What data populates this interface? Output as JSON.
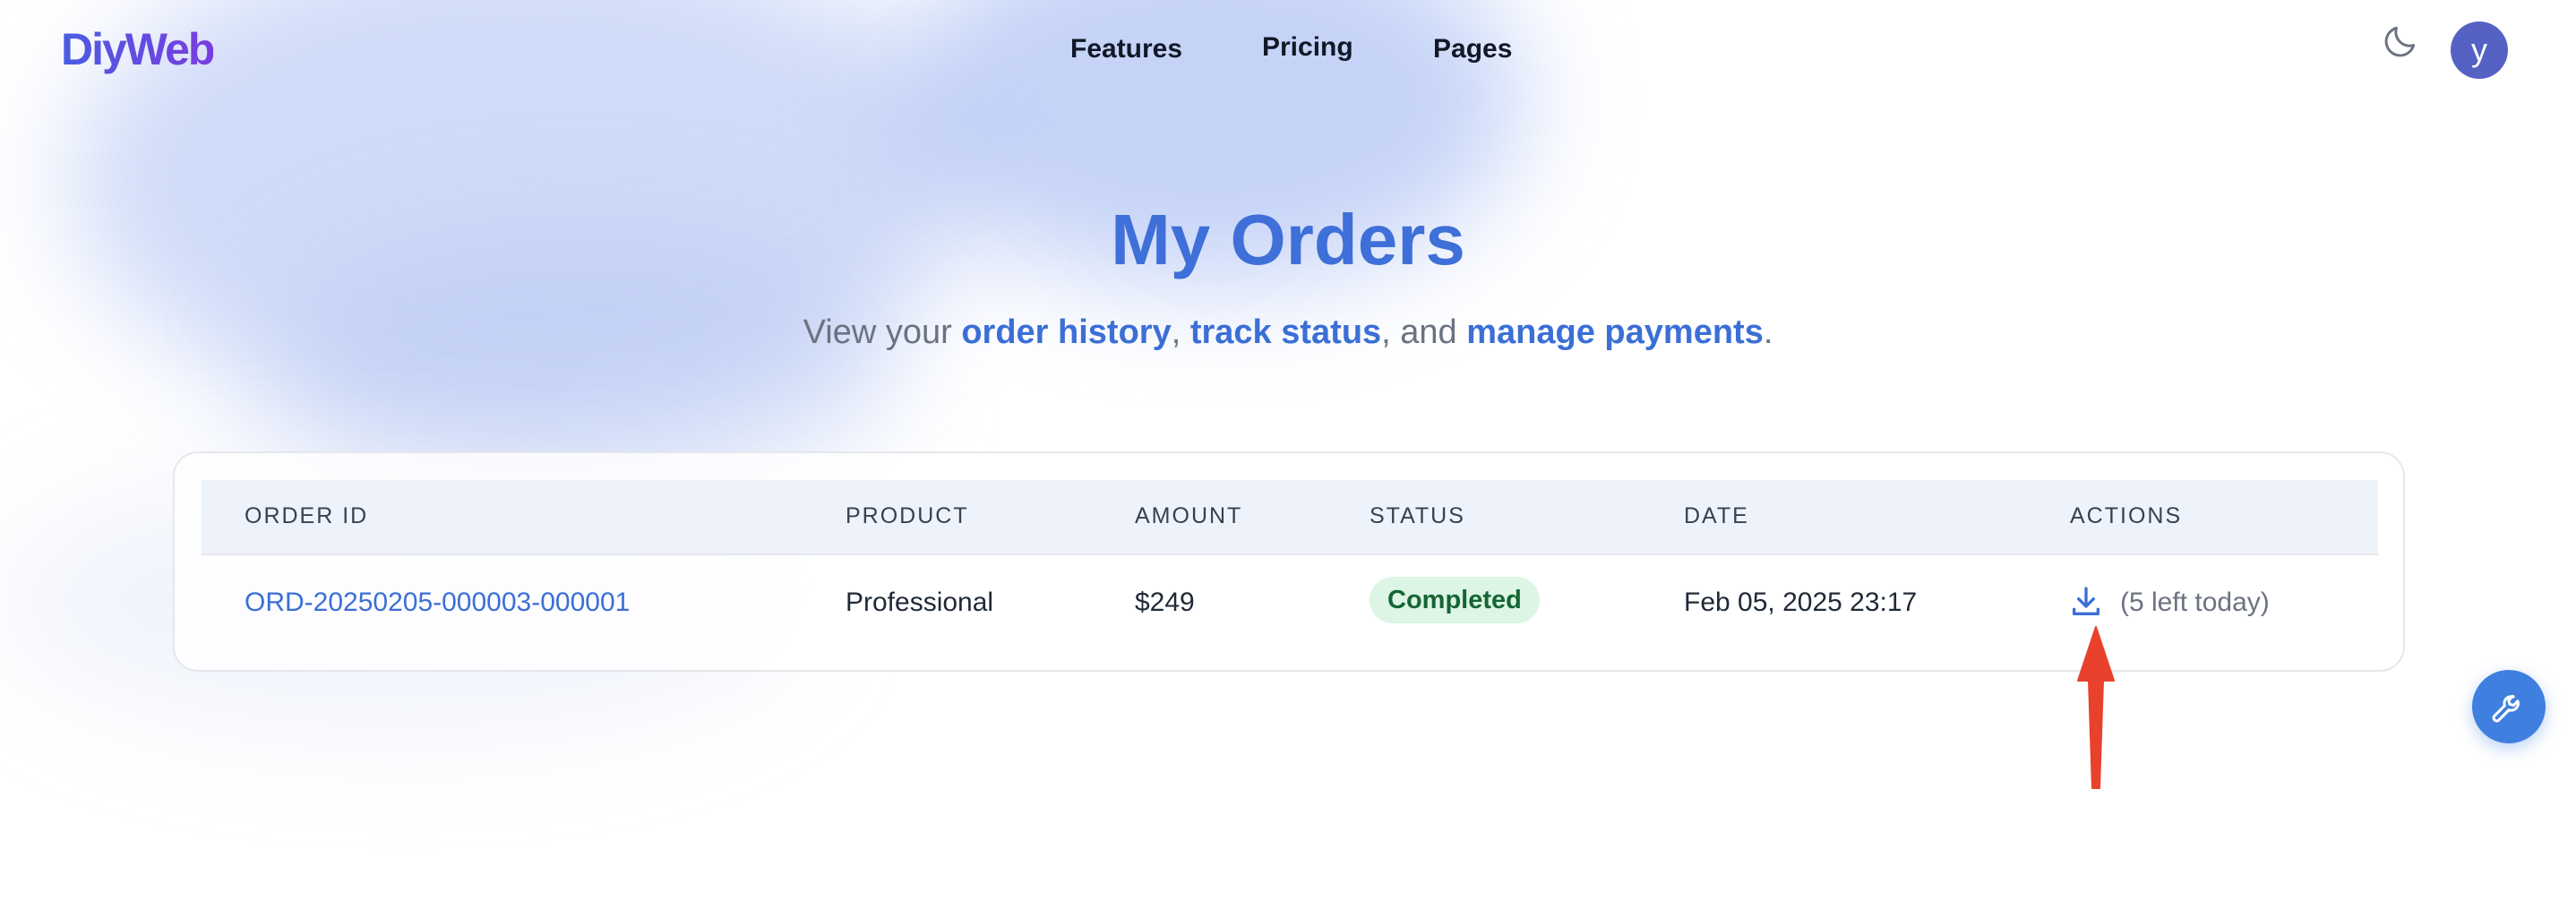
{
  "header": {
    "logo": "DiyWeb",
    "nav": [
      "Features",
      "Pricing",
      "Pages"
    ],
    "avatar_initial": "y",
    "theme_toggle_icon": "moon-icon"
  },
  "hero": {
    "title": "My Orders",
    "subtitle_parts": {
      "p1": "View your ",
      "h1": "order history",
      "p2": ", ",
      "h2": "track status",
      "p3": ", and ",
      "h3": "manage payments",
      "p4": "."
    }
  },
  "table": {
    "headers": [
      "ORDER ID",
      "PRODUCT",
      "AMOUNT",
      "STATUS",
      "DATE",
      "ACTIONS"
    ],
    "rows": [
      {
        "order_id": "ORD-20250205-000003-000001",
        "product": "Professional",
        "amount": "$249",
        "status": "Completed",
        "date": "Feb 05, 2025 23:17",
        "action_icon": "download-icon",
        "action_note": "(5 left today)"
      }
    ]
  },
  "fab": {
    "icon": "wrench-icon"
  },
  "colors": {
    "accent": "#3f6fd8",
    "status_bg": "#dcf5e4",
    "status_text": "#166534",
    "arrow": "#e8412c"
  }
}
